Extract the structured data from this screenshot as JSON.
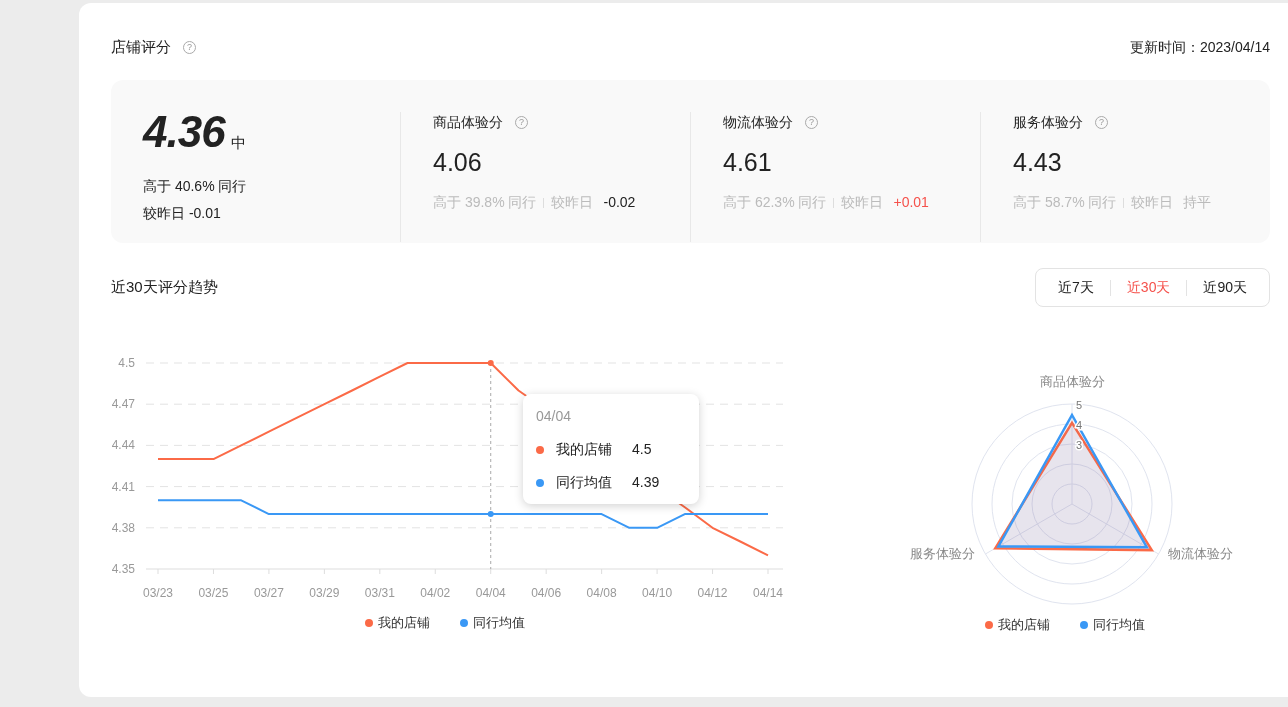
{
  "header": {
    "title": "店铺评分",
    "help": "?",
    "updated": "更新时间：2023/04/14"
  },
  "overall": {
    "score": "4.36",
    "level": "中",
    "above_peers": "高于 40.6% 同行",
    "change": "较昨日 -0.01"
  },
  "metrics": [
    {
      "label": "商品体验分",
      "help": "?",
      "value": "4.06",
      "above_peers": "高于 39.8% 同行",
      "change_label": "较昨日",
      "change": "-0.02",
      "color": "#222222"
    },
    {
      "label": "物流体验分",
      "help": "?",
      "value": "4.61",
      "above_peers": "高于 62.3% 同行",
      "change_label": "较昨日",
      "change": "+0.01",
      "color": "#f5514b"
    },
    {
      "label": "服务体验分",
      "help": "?",
      "value": "4.43",
      "above_peers": "高于 58.7% 同行",
      "change_label": "较昨日",
      "change": "持平",
      "color": "#bbbbbb"
    }
  ],
  "trend": {
    "title": "近30天评分趋势",
    "ranges": [
      {
        "label": "近7天",
        "selected": false
      },
      {
        "label": "近30天",
        "selected": true
      },
      {
        "label": "近90天",
        "selected": false
      }
    ],
    "line_chart": {
      "chart_data": {
        "type": "line",
        "categories": [
          "03/23",
          null,
          "03/25",
          null,
          "03/27",
          null,
          "03/29",
          null,
          "03/31",
          null,
          "04/02",
          null,
          "04/04",
          null,
          "04/06",
          null,
          "04/08",
          null,
          "04/10",
          null,
          "04/12",
          null,
          "04/14"
        ],
        "series": [
          {
            "name": "我的店铺",
            "color": "#fb6a47",
            "values": [
              4.43,
              4.43,
              4.43,
              4.44,
              4.45,
              4.46,
              4.47,
              4.48,
              4.49,
              4.5,
              4.5,
              4.5,
              4.5,
              4.48,
              null,
              null,
              null,
              null,
              null,
              4.395,
              4.38,
              4.37,
              4.36
            ]
          },
          {
            "name": "同行均值",
            "color": "#3a98f5",
            "values": [
              4.4,
              4.4,
              4.4,
              4.4,
              4.39,
              4.39,
              4.39,
              4.39,
              4.39,
              4.39,
              4.39,
              4.39,
              4.39,
              4.39,
              4.39,
              4.39,
              4.39,
              4.38,
              4.38,
              4.39,
              4.39,
              4.39,
              4.39
            ]
          }
        ],
        "ylim": [
          4.35,
          4.5
        ],
        "yticks": [
          4.35,
          4.38,
          4.41,
          4.44,
          4.47,
          4.5
        ],
        "grid": true,
        "ref_lines": [
          {
            "axis": "x",
            "value": "04/04"
          }
        ]
      },
      "tooltip": {
        "title": "04/04",
        "items": [
          {
            "name": "我的店铺",
            "value": "4.5",
            "color": "#fb6a47"
          },
          {
            "name": "同行均值",
            "value": "4.39",
            "color": "#3a98f5"
          }
        ]
      }
    },
    "radar_chart": {
      "chart_data": {
        "type": "radar",
        "categories": [
          "商品体验分",
          "物流体验分",
          "服务体验分"
        ],
        "series": [
          {
            "name": "我的店铺",
            "color": "#fb6a47",
            "values": [
              4.06,
              4.61,
              4.43
            ]
          },
          {
            "name": "同行均值",
            "color": "#3a98f5",
            "values": [
              4.45,
              4.32,
              4.25
            ]
          }
        ],
        "ylim": [
          0,
          5
        ],
        "yticks": [
          3,
          4,
          5
        ]
      }
    }
  }
}
